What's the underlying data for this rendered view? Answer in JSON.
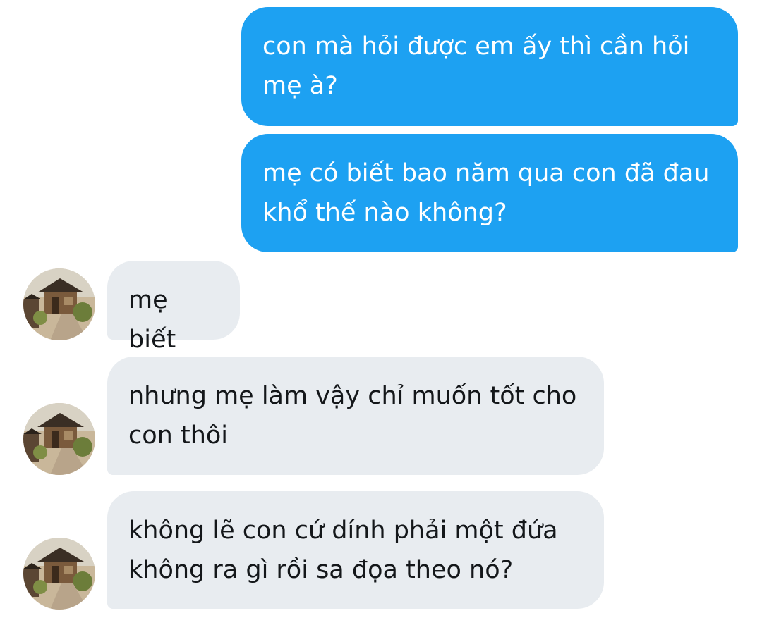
{
  "messages": [
    {
      "direction": "sent",
      "text": "con mà hỏi được em ấy thì cần hỏi\nmẹ à?"
    },
    {
      "direction": "sent",
      "text": "mẹ có biết bao năm qua con đã đau\nkhổ thế nào không?"
    },
    {
      "direction": "received",
      "text": "mẹ biết"
    },
    {
      "direction": "received",
      "text": "nhưng mẹ làm vậy chỉ muốn tốt cho\ncon thôi"
    },
    {
      "direction": "received",
      "text": "không lẽ con cứ dính phải một đứa\nkhông ra gì rồi sa đọa theo nó?"
    }
  ],
  "colors": {
    "sent_bubble": "#1da1f2",
    "received_bubble": "#e8ecf0",
    "sent_text": "#ffffff",
    "received_text": "#14171a"
  },
  "avatar": {
    "icon": "traditional-village-photo"
  }
}
